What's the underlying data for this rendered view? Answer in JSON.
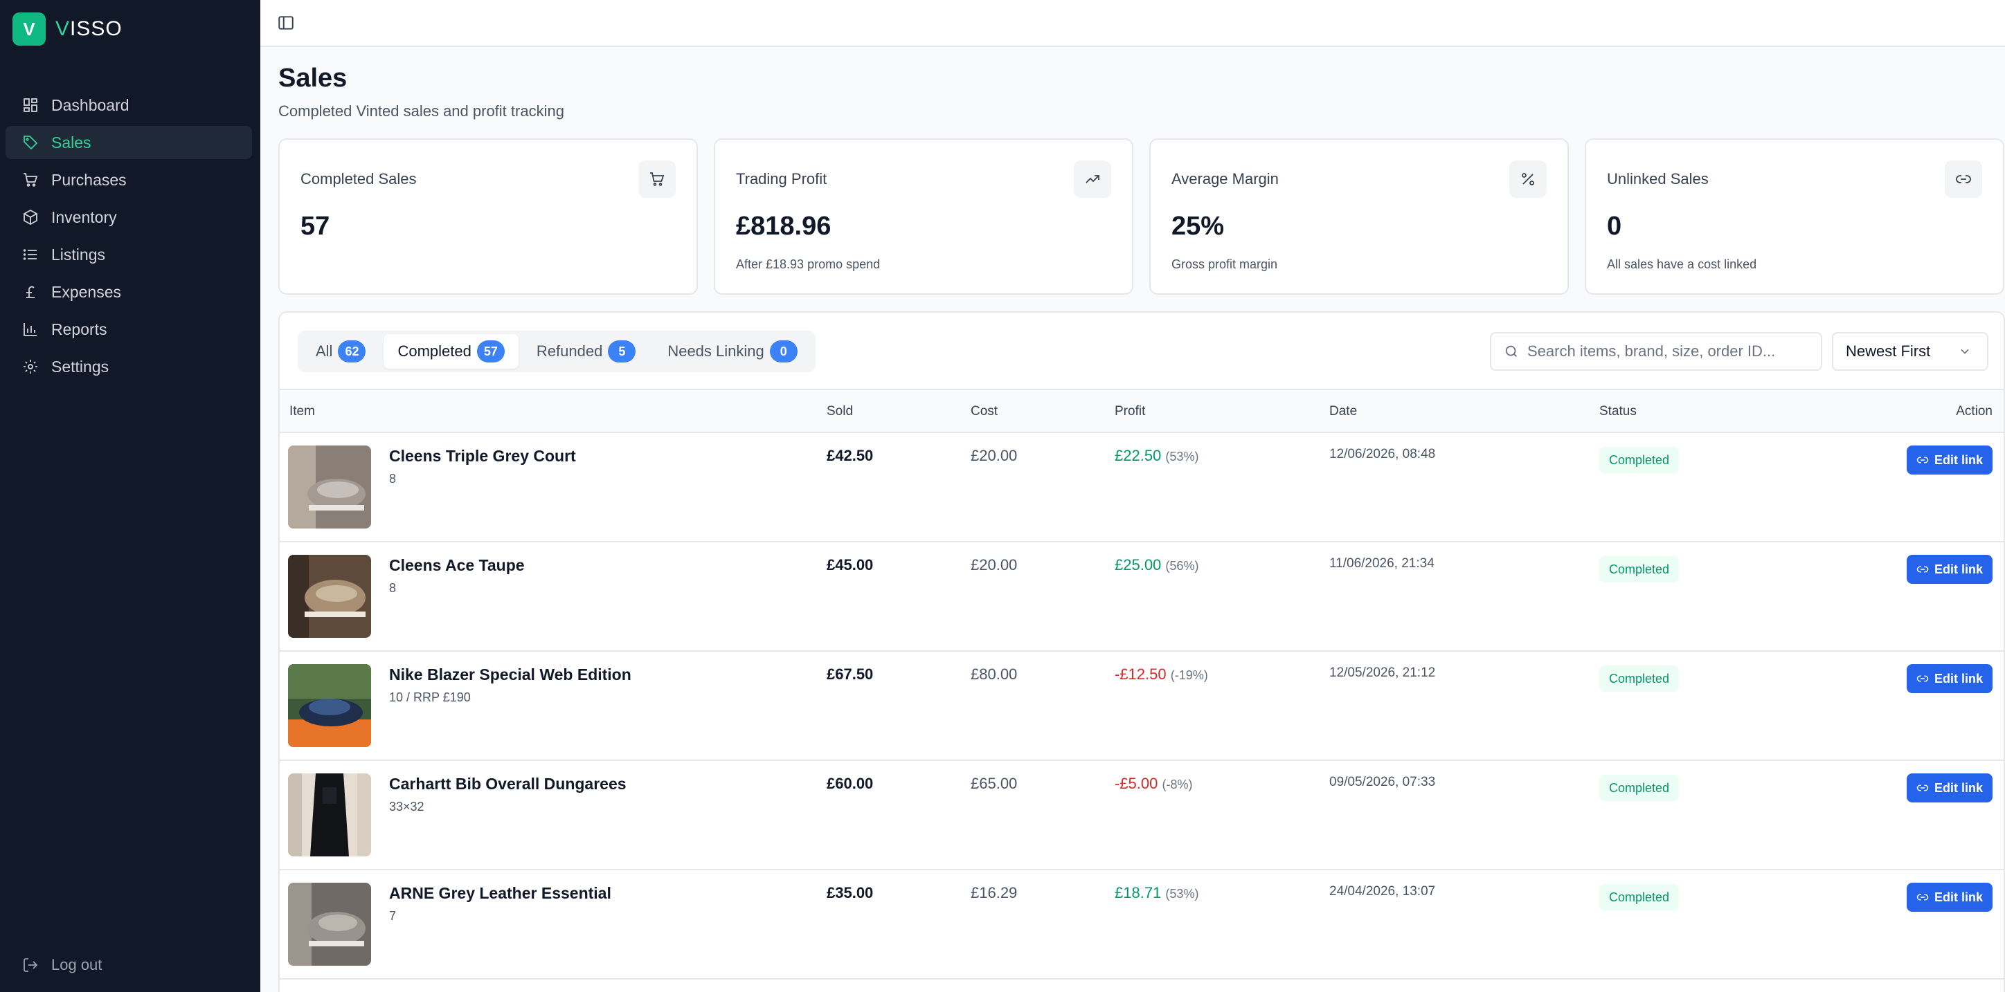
{
  "brand": {
    "mark": "V",
    "name_accent": "V",
    "name_rest": "ISSO"
  },
  "nav": {
    "items": [
      {
        "label": "Dashboard",
        "icon": "dashboard-icon"
      },
      {
        "label": "Sales",
        "icon": "tag-icon",
        "active": true
      },
      {
        "label": "Purchases",
        "icon": "cart-icon"
      },
      {
        "label": "Inventory",
        "icon": "box-icon"
      },
      {
        "label": "Listings",
        "icon": "list-icon"
      },
      {
        "label": "Expenses",
        "icon": "pound-icon"
      },
      {
        "label": "Reports",
        "icon": "bar-chart-icon"
      },
      {
        "label": "Settings",
        "icon": "gear-icon"
      }
    ],
    "logout": "Log out"
  },
  "header": {
    "title": "Sales",
    "subtitle": "Completed Vinted sales and profit tracking"
  },
  "stats": [
    {
      "label": "Completed Sales",
      "value": "57",
      "sub": "",
      "icon": "cart-icon"
    },
    {
      "label": "Trading Profit",
      "value": "£818.96",
      "sub": "After £18.93 promo spend",
      "icon": "trending-up-icon"
    },
    {
      "label": "Average Margin",
      "value": "25%",
      "sub": "Gross profit margin",
      "icon": "percent-icon"
    },
    {
      "label": "Unlinked Sales",
      "value": "0",
      "sub": "All sales have a cost linked",
      "icon": "link-icon"
    }
  ],
  "tabs": [
    {
      "label": "All",
      "count": "62"
    },
    {
      "label": "Completed",
      "count": "57",
      "active": true
    },
    {
      "label": "Refunded",
      "count": "5"
    },
    {
      "label": "Needs Linking",
      "count": "0"
    }
  ],
  "search": {
    "placeholder": "Search items, brand, size, order ID...",
    "value": ""
  },
  "sort": {
    "selected": "Newest First"
  },
  "table": {
    "headers": {
      "item": "Item",
      "sold": "Sold",
      "cost": "Cost",
      "profit": "Profit",
      "date": "Date",
      "status": "Status",
      "action": "Action"
    },
    "rows": [
      {
        "name": "Cleens Triple Grey Court",
        "sub": "8",
        "sold": "£42.50",
        "cost": "£20.00",
        "profit": "£22.50",
        "profit_pct": "(53%)",
        "positive": true,
        "date": "12/06/2026, 08:48",
        "status": "Completed",
        "action": "Edit link"
      },
      {
        "name": "Cleens Ace Taupe",
        "sub": "8",
        "sold": "£45.00",
        "cost": "£20.00",
        "profit": "£25.00",
        "profit_pct": "(56%)",
        "positive": true,
        "date": "11/06/2026, 21:34",
        "status": "Completed",
        "action": "Edit link"
      },
      {
        "name": "Nike Blazer Special Web Edition",
        "sub": "10 / RRP £190",
        "sold": "£67.50",
        "cost": "£80.00",
        "profit": "-£12.50",
        "profit_pct": "(-19%)",
        "positive": false,
        "date": "12/05/2026, 21:12",
        "status": "Completed",
        "action": "Edit link"
      },
      {
        "name": "Carhartt Bib Overall Dungarees",
        "sub": "33×32",
        "sold": "£60.00",
        "cost": "£65.00",
        "profit": "-£5.00",
        "profit_pct": "(-8%)",
        "positive": false,
        "date": "09/05/2026, 07:33",
        "status": "Completed",
        "action": "Edit link"
      },
      {
        "name": "ARNE Grey Leather Essential",
        "sub": "7",
        "sold": "£35.00",
        "cost": "£16.29",
        "profit": "£18.71",
        "profit_pct": "(53%)",
        "positive": true,
        "date": "24/04/2026, 13:07",
        "status": "Completed",
        "action": "Edit link"
      }
    ]
  },
  "colors": {
    "sidebar_bg": "#111827",
    "accent": "#10b981",
    "primary": "#2563eb",
    "positive": "#059669",
    "negative": "#dc2626"
  }
}
